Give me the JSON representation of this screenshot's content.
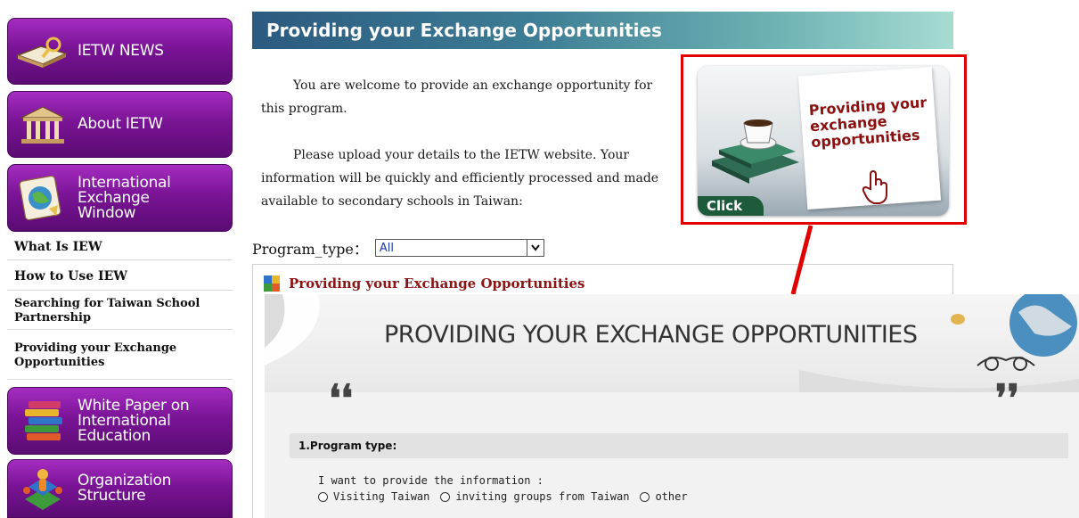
{
  "sidebar": {
    "nav_buttons": [
      {
        "label": "IETW NEWS",
        "icon": "book-magnifier-icon"
      },
      {
        "label": "About IETW",
        "icon": "building-icon"
      },
      {
        "label": "International\nExchange\nWindow",
        "icon": "globe-card-icon"
      }
    ],
    "sub_items": [
      {
        "label": "What Is IEW"
      },
      {
        "label": "How to Use IEW"
      },
      {
        "label": "Searching for Taiwan School Partnership"
      },
      {
        "label": "Providing your Exchange Opportunities"
      }
    ],
    "lower_buttons": [
      {
        "label": "White Paper on\nInternational\nEducation",
        "icon": "books-stack-icon"
      },
      {
        "label": "Organization\nStructure",
        "icon": "org-structure-icon"
      }
    ]
  },
  "main": {
    "title": "Providing your Exchange Opportunities",
    "para1": "You are welcome to provide an exchange opportunity for this program.",
    "para2": "Please upload your details to the IETW website. Your information will be quickly and efficiently processed and made available to secondary schools in Taiwan:",
    "program_type_label": "Program_type：",
    "program_type_value": "All",
    "content_heading": "Providing your Exchange Opportunities"
  },
  "callout": {
    "card_text": "Providing your exchange opportunities",
    "click_label": "Click"
  },
  "overlay": {
    "title": "PROVIDING YOUR EXCHANGE OPPORTUNITIES",
    "section_label": "1.Program type:",
    "question": "I want to provide the information :",
    "options": [
      "Visiting Taiwan",
      "inviting groups from Taiwan",
      "other"
    ]
  },
  "colors": {
    "sidebar_purple": "#7a1496",
    "title_teal": "#3d7d95",
    "highlight_red": "#e00000",
    "heading_red": "#8a1515",
    "select_text_blue": "#1a3aa8"
  }
}
